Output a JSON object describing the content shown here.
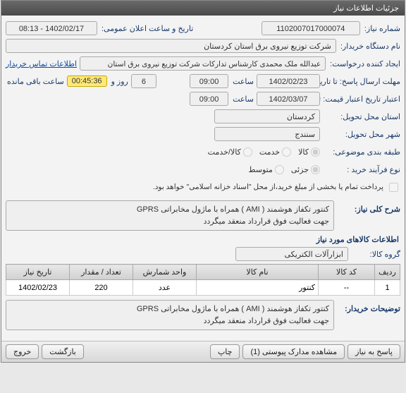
{
  "window": {
    "title": "جزئیات اطلاعات نیاز"
  },
  "labels": {
    "need_no": "شماره نیاز:",
    "announce_datetime": "تاریخ و ساعت اعلان عمومی:",
    "buyer_org": "نام دستگاه خریدار:",
    "requester": "ایجاد کننده درخواست:",
    "contact_link": "اطلاعات تماس خریدار",
    "response_deadline": "مهلت ارسال پاسخ: تا تاریخ:",
    "hour": "ساعت",
    "days_and": "روز و",
    "time_remaining": "ساعت باقی مانده",
    "price_validity": "اعتبار تاریخ اعتبار قیمت: تا تاریخ:",
    "province": "استان محل تحویل:",
    "city": "شهر محل تحویل:",
    "category": "طبقه بندی موضوعی:",
    "goods": "کالا",
    "service": "خدمت",
    "goods_service": "کالا/خدمت",
    "process_type": "نوع فرآیند خرید :",
    "partial": "جزئی",
    "medium": "متوسط",
    "payment_note": "پرداخت تمام یا بخشی از مبلغ خرید،از محل \"اسناد خزانه اسلامی\" خواهد بود.",
    "need_desc": "شرح کلی نیاز:",
    "goods_info_title": "اطلاعات کالاهای مورد نیاز",
    "goods_group": "گروه کالا:",
    "buyer_remarks": "توضیحات خریدار:"
  },
  "fields": {
    "need_no": "1102007017000074",
    "announce_datetime": "1402/02/17 - 08:13",
    "buyer_org": "شرکت توزیع نیروی برق استان کردستان",
    "requester": "عبدالله ملک محمدی کارشناس تدارکات شرکت توزیع نیروی برق استان کردستان",
    "response_date": "1402/02/23",
    "response_time": "09:00",
    "days": "6",
    "countdown": "00:45:36",
    "validity_date": "1402/03/07",
    "validity_time": "09:00",
    "province": "کردستان",
    "city": "سنندج",
    "need_desc_1": "کنتور تکفاز هوشمند ( AMI ) همراه با ماژول مخابراتی GPRS",
    "need_desc_2": "جهت فعالیت فوق قرارداد منعقد میگردد",
    "goods_group": "ابزارآلات الکتریکی",
    "buyer_remarks_1": "کنتور تکفاز هوشمند ( AMI ) همراه با ماژول مخابراتی GPRS",
    "buyer_remarks_2": "جهت فعالیت فوق قرارداد منعقد میگردد"
  },
  "table": {
    "headers": {
      "row": "ردیف",
      "code": "کد کالا",
      "name": "نام کالا",
      "unit": "واحد شمارش",
      "qty": "تعداد / مقدار",
      "date": "تاریخ نیاز"
    },
    "rows": [
      {
        "row": "1",
        "code": "--",
        "name": "کنتور",
        "unit": "عدد",
        "qty": "220",
        "date": "1402/02/23"
      }
    ]
  },
  "buttons": {
    "respond": "پاسخ به نیاز",
    "attachments": "مشاهده مدارک پیوستی (1)",
    "print": "چاپ",
    "back": "بازگشت",
    "exit": "خروج"
  }
}
